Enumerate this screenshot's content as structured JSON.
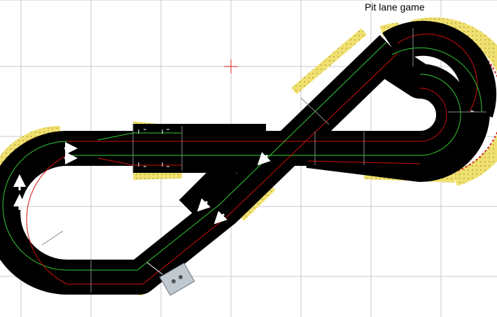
{
  "layout": {
    "title": "Pit lane game"
  },
  "colors": {
    "background": "#ffffff",
    "grid": "#c8c8c8",
    "track": "#000000",
    "lane_red": "#d01010",
    "lane_green": "#33cc33",
    "border": "#f0e070",
    "border_stripe": "#d02020",
    "marker": "#e02020"
  },
  "icons": {
    "direction_arrows": "arrow-icon",
    "origin_marker": "crosshair-icon",
    "controller": "controller-icon"
  }
}
